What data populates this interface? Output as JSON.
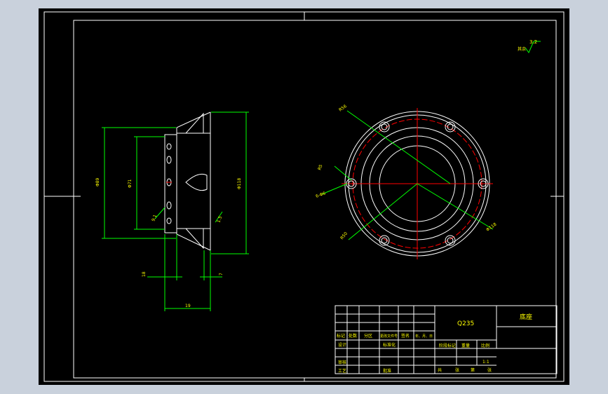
{
  "drawing": {
    "roughness_value": "3.2",
    "roughness_label": "其余",
    "dims_side": {
      "overall_height": "Φ89",
      "inner_height": "Φ71",
      "outer_diameter": "Φ118",
      "hole_size": "9.1",
      "angle": "1.5",
      "width_left": "18",
      "width_right": "7",
      "bottom": "19"
    },
    "dims_top": {
      "r1": "R56",
      "r2": "R5",
      "r3": "6-Φ6",
      "r4": "R50",
      "r5": "Φ118"
    }
  },
  "title_block": {
    "material": "Q235",
    "part_name": "底座",
    "labels": {
      "mark": "标记",
      "count": "处数",
      "zone": "分区",
      "doc_no": "更改文件号",
      "sign": "签名",
      "date": "年、月、日",
      "designer": "设计",
      "standardize": "标准化",
      "stage_mark": "阶段标记",
      "weight": "重量",
      "scale": "比例",
      "checker": "审核",
      "craft": "工艺",
      "approve": "批准",
      "total": "共",
      "sheet_unit": "张",
      "page": "第",
      "page_unit": "张"
    },
    "scale_value": "1:1"
  }
}
